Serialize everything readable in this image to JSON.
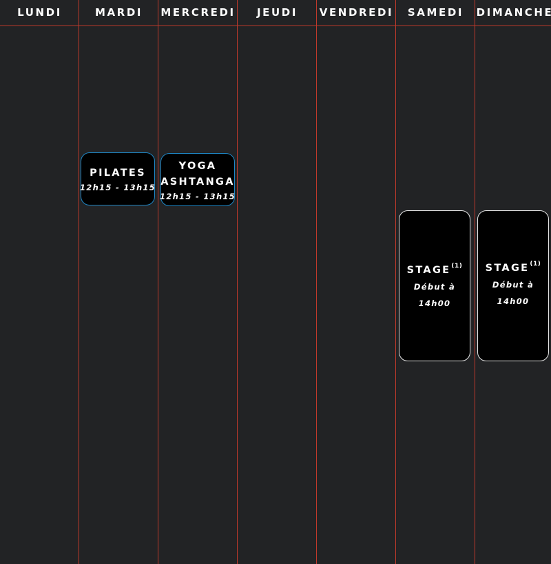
{
  "days": [
    "LUNDI",
    "MARDI",
    "MERCREDI",
    "JEUDI",
    "VENDREDI",
    "SAMEDI",
    "DIMANCHE"
  ],
  "events": {
    "pilates": {
      "title": "PILATES",
      "time": "12h15 - 13h15"
    },
    "yoga": {
      "title_line1": "YOGA",
      "title_line2": "ASHTANGA",
      "time": "12h15 - 13h15"
    },
    "stage_samedi": {
      "title": "STAGE",
      "note_marker": "(1)",
      "sub_line1": "Début à",
      "sub_line2": "14h00"
    },
    "stage_dimanche": {
      "title": "STAGE",
      "note_marker": "(1)",
      "sub_line1": "Début à",
      "sub_line2": "14h00"
    }
  },
  "colors": {
    "background": "#222325",
    "grid_line": "#c0392b",
    "accent_border": "#1e88c8",
    "event_background": "#000000"
  }
}
